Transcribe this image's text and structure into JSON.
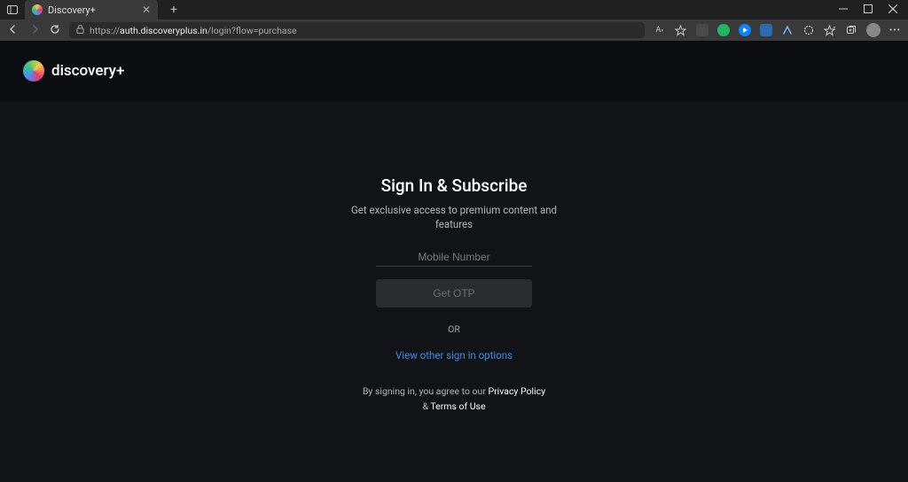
{
  "browser": {
    "tab_title": "Discovery+",
    "url_prefix": "https://",
    "url_host": "auth.discoveryplus.in",
    "url_path": "/login?flow=purchase"
  },
  "page": {
    "logo_text": "discovery+",
    "title": "Sign In & Subscribe",
    "subtitle": "Get exclusive access to premium content and features",
    "mobile_placeholder": "Mobile Number",
    "otp_button": "Get OTP",
    "or": "OR",
    "other_options": "View other sign in options",
    "legal_prefix": "By signing in, you agree to our ",
    "privacy": "Privacy Policy",
    "legal_amp": " & ",
    "terms": "Terms of Use"
  }
}
